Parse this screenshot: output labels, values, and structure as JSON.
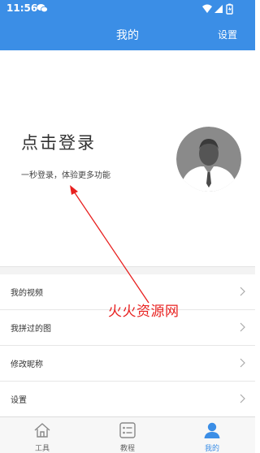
{
  "status_bar": {
    "time": "11:56"
  },
  "nav": {
    "title": "我的",
    "settings": "设置"
  },
  "profile": {
    "login_title": "点击登录",
    "login_subtitle": "一秒登录，体验更多功能"
  },
  "menu": [
    {
      "label": "我的视频"
    },
    {
      "label": "我拼过的图"
    },
    {
      "label": "修改昵称"
    },
    {
      "label": "设置"
    }
  ],
  "watermark": "火火资源网",
  "tabs": [
    {
      "label": "工具",
      "icon": "home-icon",
      "active": false
    },
    {
      "label": "教程",
      "icon": "list-icon",
      "active": false
    },
    {
      "label": "我的",
      "icon": "person-icon",
      "active": true
    }
  ],
  "colors": {
    "accent": "#3b8ee6",
    "annotation": "#e8201f"
  }
}
